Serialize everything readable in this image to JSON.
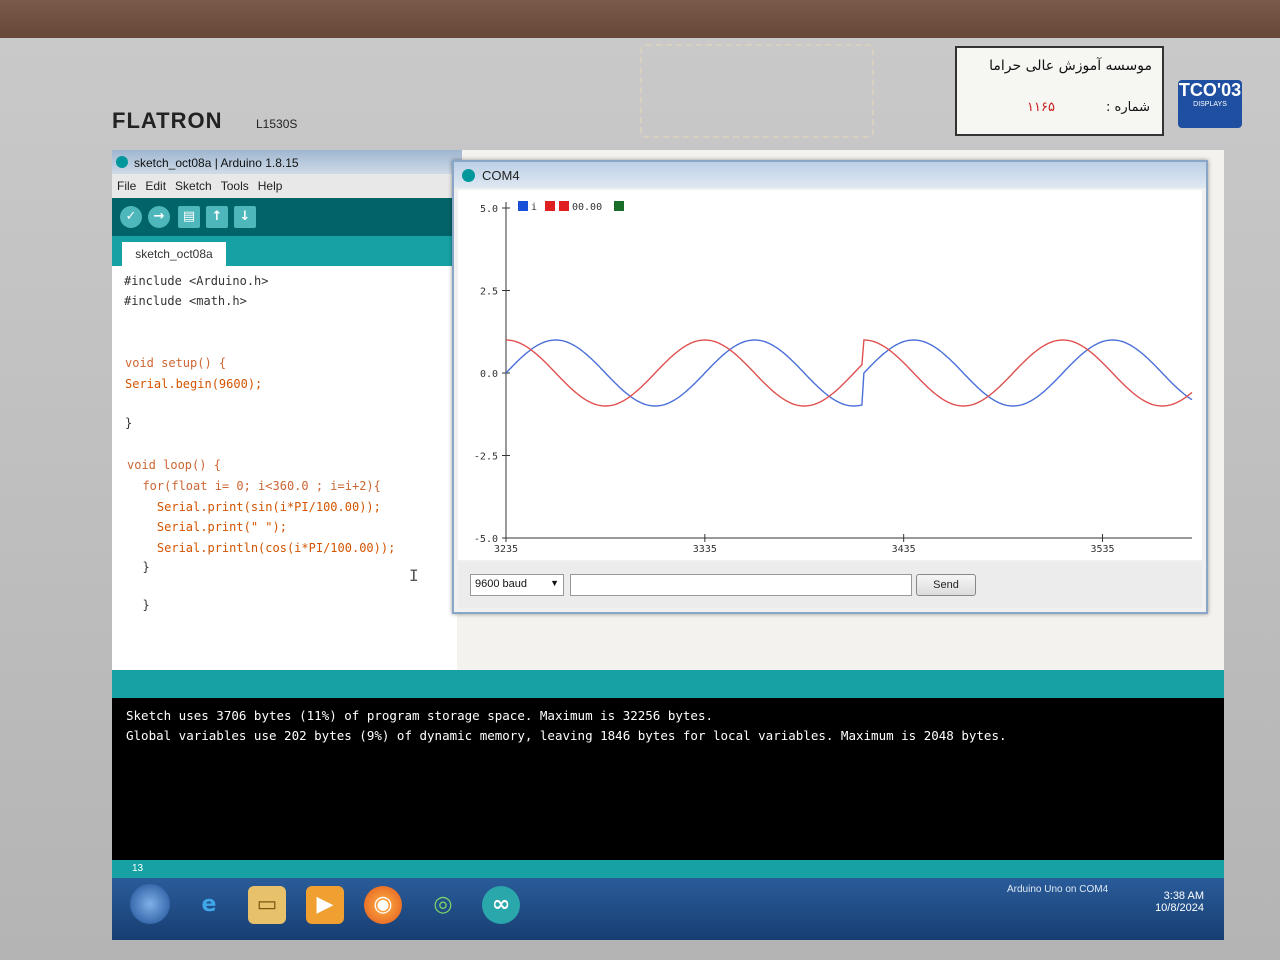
{
  "monitor": {
    "brand": "FLATRON",
    "model": "L1530S",
    "sticker_line1": "موسسه آموزش عالی حراما",
    "sticker_line2": "شماره :",
    "sticker_number": "۱۱۶۵",
    "tco_label": "TCO'03",
    "tco_sub": "DISPLAYS"
  },
  "ide": {
    "window_title": "sketch_oct08a | Arduino 1.8.15",
    "menu": [
      "File",
      "Edit",
      "Sketch",
      "Tools",
      "Help"
    ],
    "toolbar_icons": [
      "verify-icon",
      "upload-icon",
      "new-icon",
      "open-icon",
      "save-icon"
    ],
    "tab_label": "sketch_oct08a",
    "code_lines": [
      "#include <Arduino.h>",
      "#include <math.h>",
      "",
      "",
      "void setup() {",
      "Serial.begin(9600);",
      "",
      "}",
      "",
      "void loop() {",
      "  for(float i= 0; i<360.0 ; i=i+2){",
      "    Serial.print(sin(i*PI/100.00));",
      "    Serial.print(\" \");",
      "    Serial.println(cos(i*PI/100.00));",
      "  }",
      "",
      "  }"
    ],
    "console_lines": [
      "Sketch uses 3706 bytes (11%) of program storage space. Maximum is 32256 bytes.",
      "Global variables use 202 bytes (9%) of dynamic memory, leaving 1846 bytes for local variables. Maximum is 2048 bytes."
    ],
    "status_line": "13",
    "board_status": "Arduino Uno on COM4"
  },
  "serial_plotter": {
    "window_title": "COM4",
    "legend": [
      "",
      "",
      "00.00",
      ""
    ],
    "legend_colors": [
      "#1a4fd8",
      "#e02020",
      "#e02020",
      "#1b6e2a"
    ],
    "legend_text": "i",
    "baud": "9600 baud",
    "send_label": "Send"
  },
  "chart_data": {
    "type": "line",
    "ylim": [
      -5.0,
      5.0
    ],
    "xlim": [
      3235,
      3580
    ],
    "yticks": [
      "5.0",
      "2.5",
      "0.0",
      "-2.5",
      "-5.0"
    ],
    "xticks": [
      "3235",
      "3335",
      "3435",
      "3535"
    ],
    "series": [
      {
        "color": "#4a6fd8",
        "formula": "sin(i*PI/100.00)",
        "amplitude": 1.0
      },
      {
        "color": "#e05050",
        "formula": "cos(i*PI/100.00)",
        "amplitude": 1.0
      }
    ]
  },
  "taskbar": {
    "time": "3:38 AM",
    "date": "10/8/2024",
    "apps": [
      "windows-explorer-icon",
      "internet-explorer-icon",
      "folder-icon",
      "media-player-icon",
      "firefox-icon",
      "shell-icon",
      "arduino-icon"
    ]
  }
}
